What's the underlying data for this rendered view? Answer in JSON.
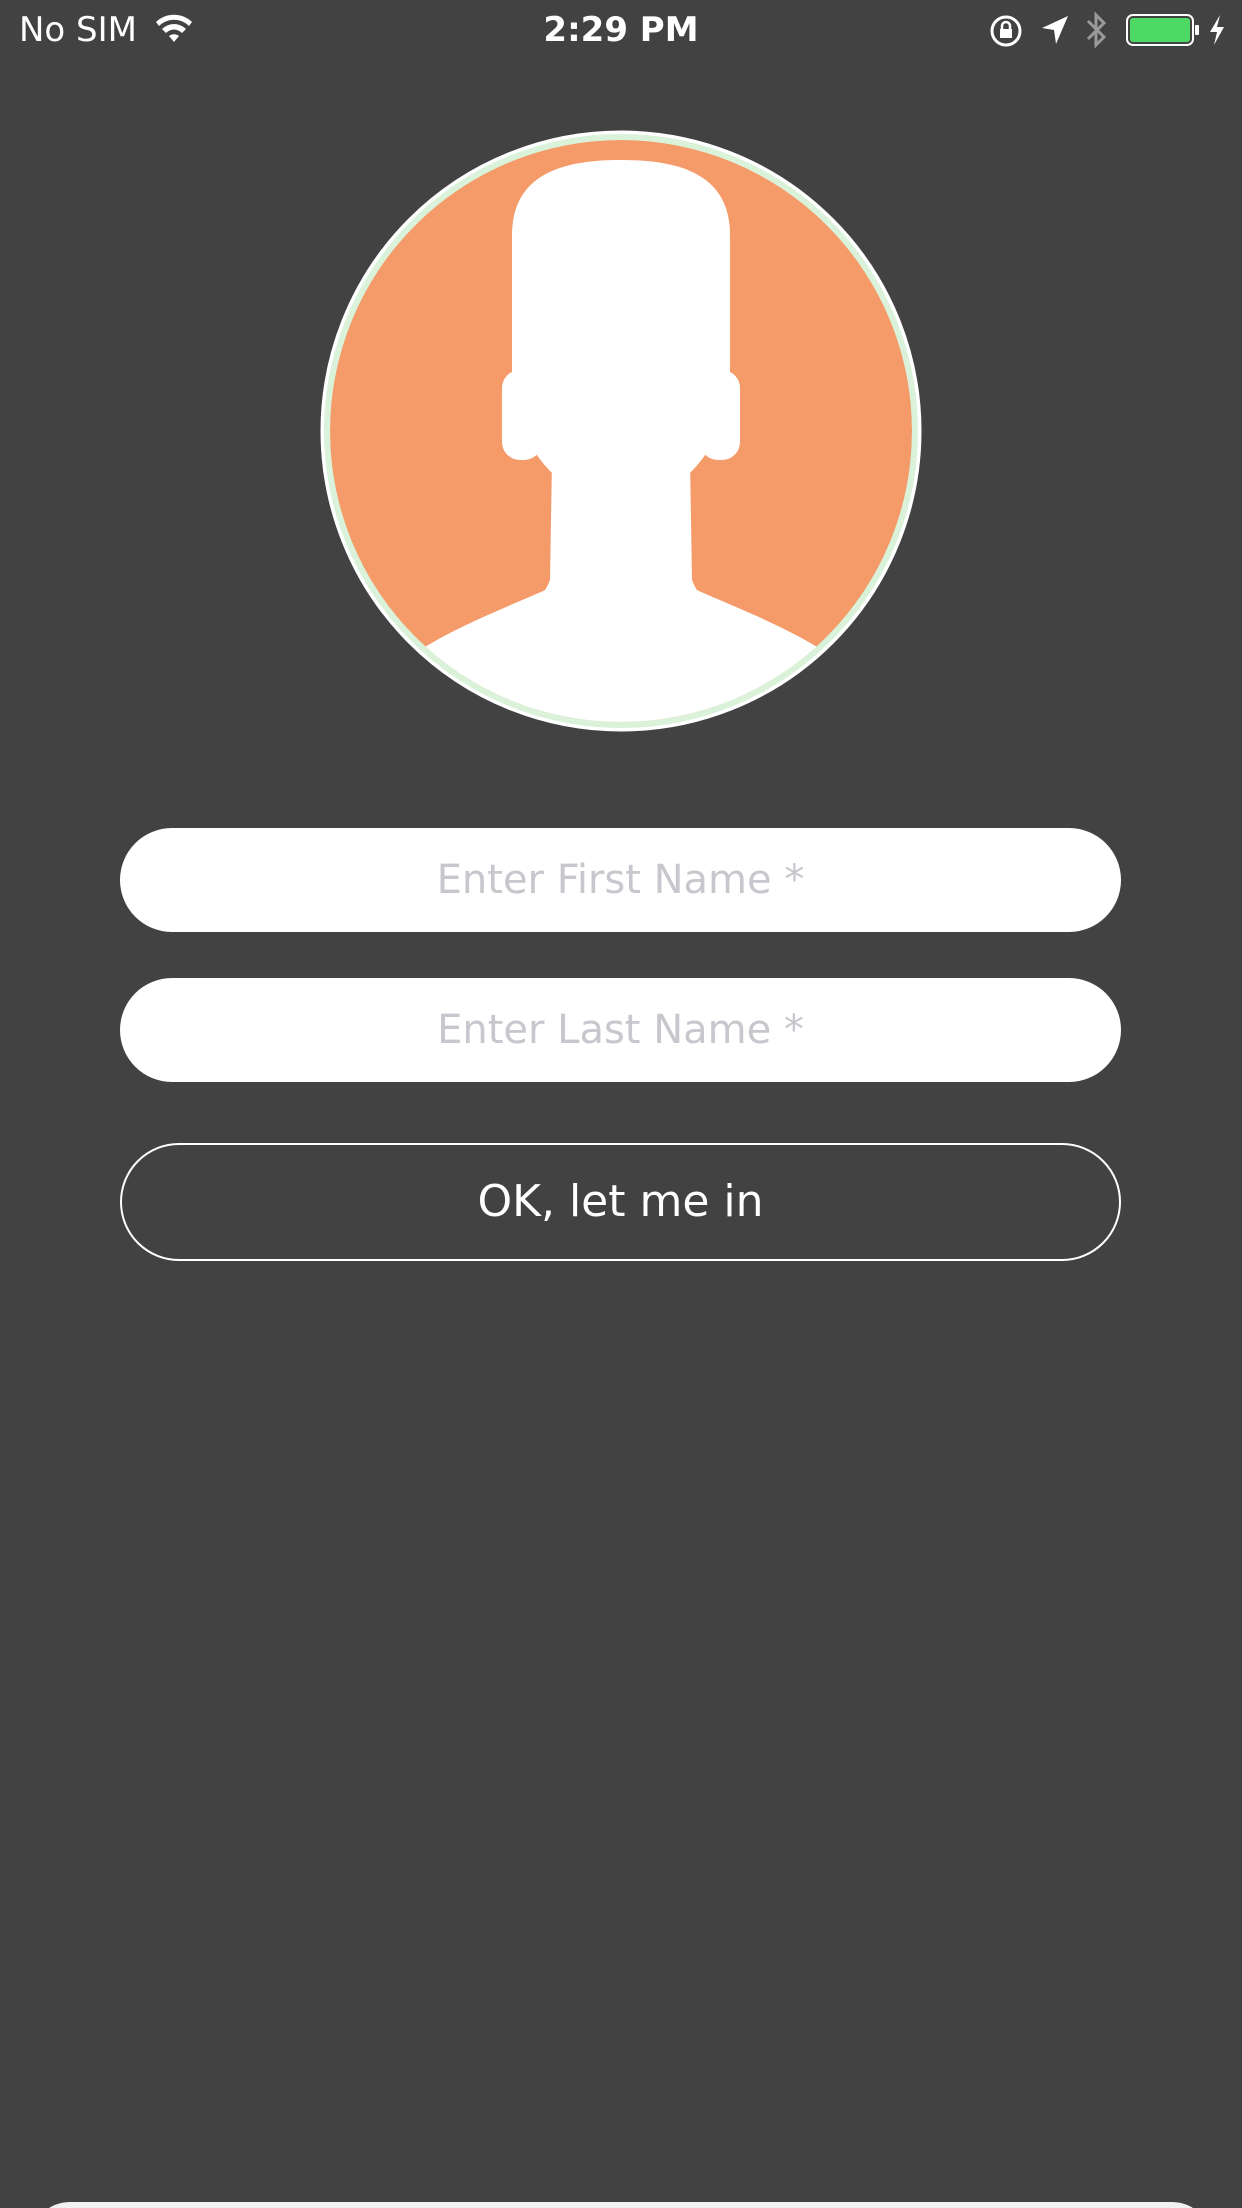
{
  "status_bar": {
    "carrier": "No SIM",
    "time": "2:29 PM",
    "battery_color": "#4cd964"
  },
  "avatar": {
    "background_color": "#f59a69",
    "ring_color": "#d9f2d9",
    "icon": "user-silhouette-icon"
  },
  "form": {
    "first_name_placeholder": "Enter First Name *",
    "last_name_placeholder": "Enter Last Name *",
    "submit_label": "OK, let me in"
  },
  "theme": {
    "background": "#424242"
  }
}
